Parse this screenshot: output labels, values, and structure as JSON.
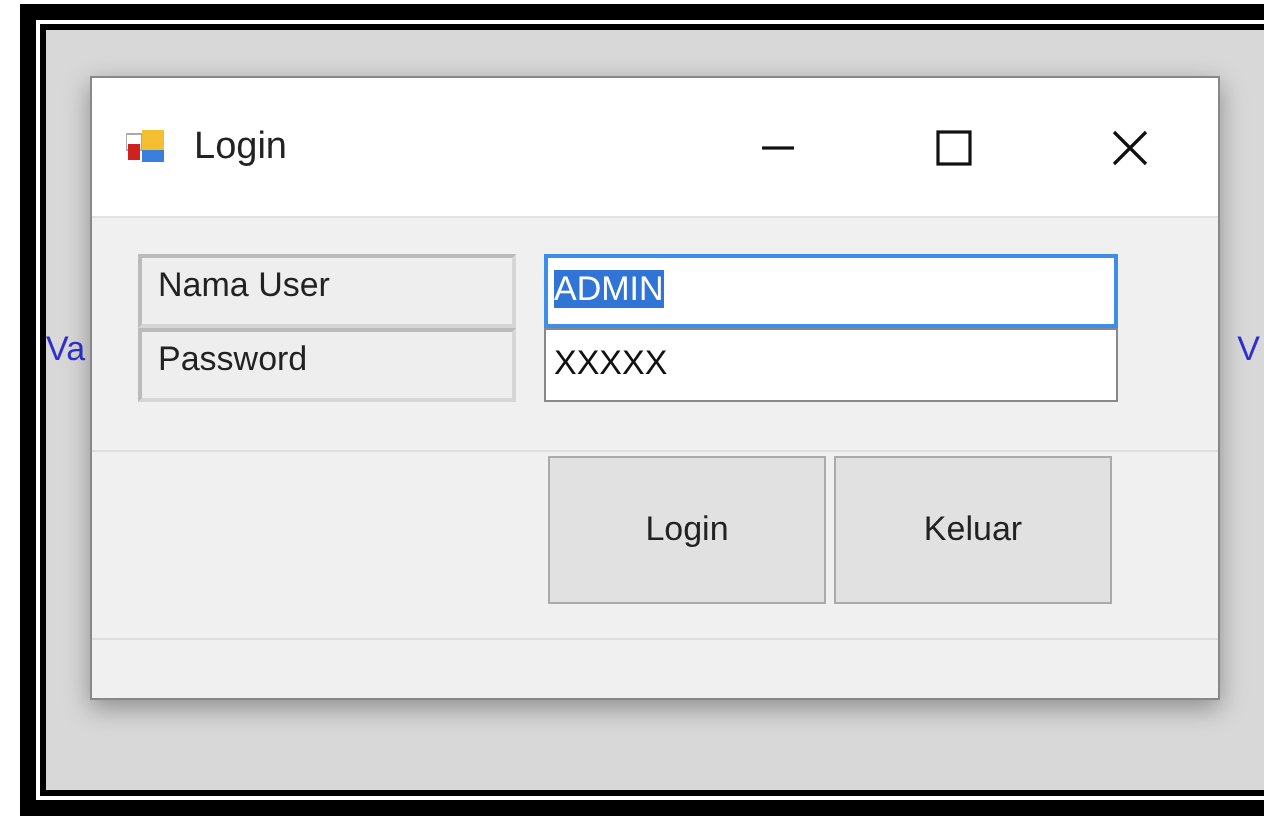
{
  "background_text": {
    "left": "Va",
    "right": "V"
  },
  "window": {
    "title": "Login"
  },
  "fields": [
    {
      "label": "Nama User",
      "value": "ADMIN",
      "focused": true
    },
    {
      "label": "Password",
      "value": "XXXXX",
      "focused": false
    }
  ],
  "buttons": [
    "Login",
    "Keluar"
  ]
}
